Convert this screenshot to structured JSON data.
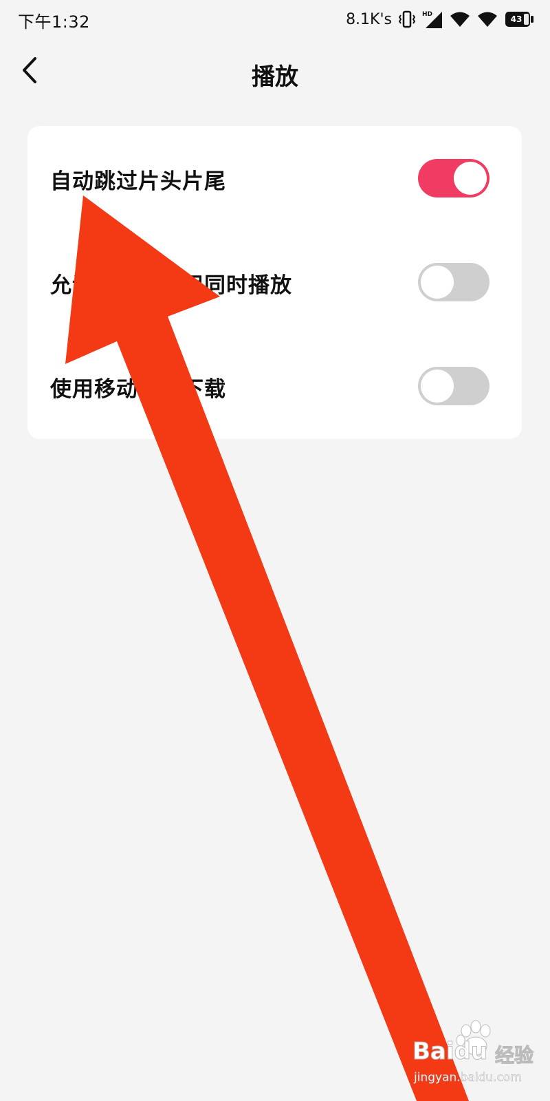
{
  "status_bar": {
    "time": "下午1:32",
    "network_speed": "8.1K's",
    "battery_level": "43",
    "icons": [
      "vibrate-icon",
      "hd-signal-icon",
      "wifi-icon",
      "wifi-icon",
      "battery-icon"
    ]
  },
  "header": {
    "title": "播放",
    "back_icon": "chevron-left-icon"
  },
  "settings": [
    {
      "label": "自动跳过片头片尾",
      "enabled": true
    },
    {
      "label": "允许与其他应用同时播放",
      "enabled": false
    },
    {
      "label": "使用移动网络下载",
      "enabled": false
    }
  ],
  "colors": {
    "background": "#f5f4f5",
    "card": "#ffffff",
    "toggle_on": "#f03c62",
    "toggle_off": "#cfcfcf",
    "annotation_arrow": "#f33a15"
  },
  "watermark": {
    "brand": "Baidu",
    "product": "经验",
    "url": "jingyan.baidu.com"
  }
}
